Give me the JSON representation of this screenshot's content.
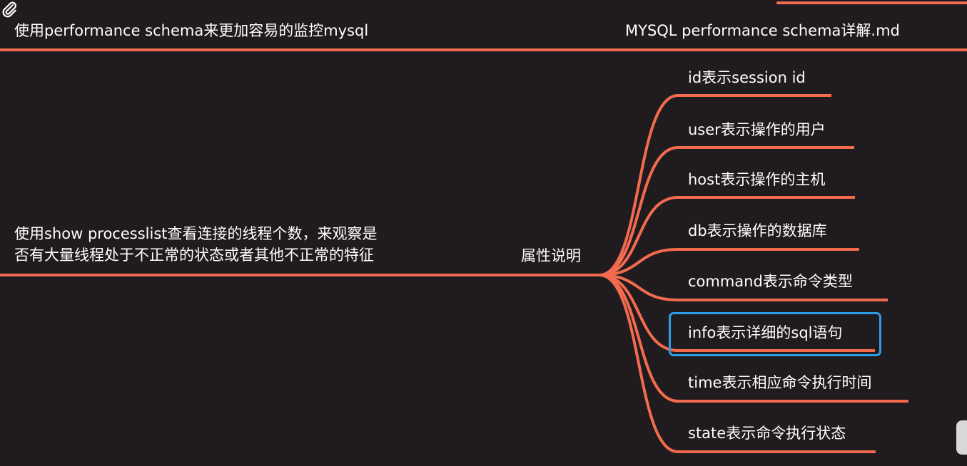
{
  "top_node": {
    "title": "使用performance schema来更加容易的监控mysql",
    "link": "MYSQL performance schema详解.md"
  },
  "main_node": {
    "line1": "使用show processlist查看连接的线程个数，来观察是",
    "line2": "否有大量线程处于不正常的状态或者其他不正常的特征"
  },
  "branch_node": {
    "label": "属性说明"
  },
  "children": [
    {
      "label": "id表示session id"
    },
    {
      "label": "user表示操作的用户"
    },
    {
      "label": "host表示操作的主机"
    },
    {
      "label": "db表示操作的数据库"
    },
    {
      "label": "command表示命令类型"
    },
    {
      "label": "info表示详细的sql语句"
    },
    {
      "label": "time表示相应命令执行时间"
    },
    {
      "label": "state表示命令执行状态"
    }
  ],
  "colors": {
    "background": "#201b1e",
    "branch": "#f26b4f",
    "text": "#ffffff",
    "selection": "#2d9ee6"
  },
  "icons": {
    "attachment": "paperclip-icon"
  },
  "selected_child": "info表示详细的sql语句"
}
